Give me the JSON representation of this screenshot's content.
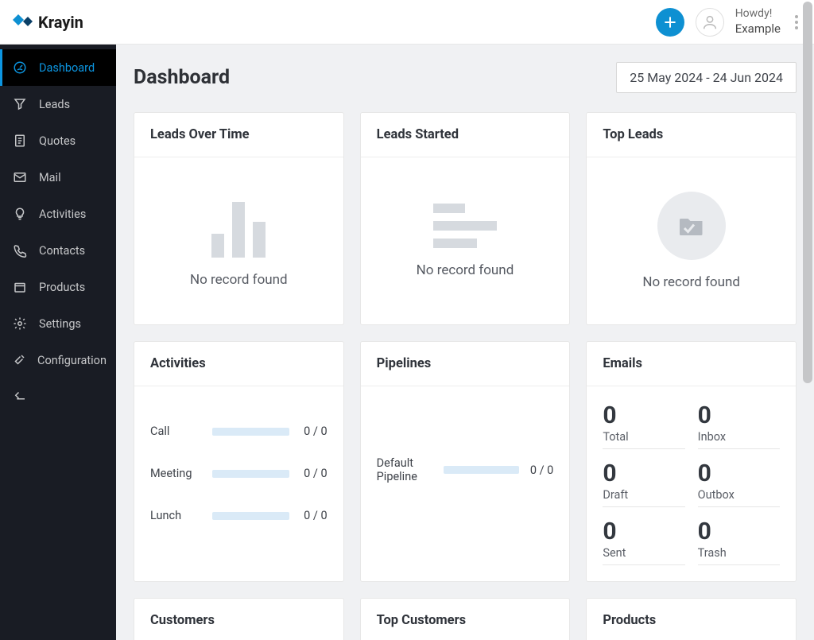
{
  "app_name": "Krayin",
  "header": {
    "greeting": "Howdy!",
    "user_name": "Example"
  },
  "sidebar": {
    "items": [
      {
        "label": "Dashboard"
      },
      {
        "label": "Leads"
      },
      {
        "label": "Quotes"
      },
      {
        "label": "Mail"
      },
      {
        "label": "Activities"
      },
      {
        "label": "Contacts"
      },
      {
        "label": "Products"
      },
      {
        "label": "Settings"
      },
      {
        "label": "Configuration"
      }
    ]
  },
  "page": {
    "title": "Dashboard",
    "date_range": "25 May 2024 - 24 Jun 2024",
    "no_record": "No record found"
  },
  "cards": {
    "leads_over_time": {
      "title": "Leads Over Time"
    },
    "leads_started": {
      "title": "Leads Started"
    },
    "top_leads": {
      "title": "Top Leads"
    },
    "activities": {
      "title": "Activities",
      "rows": [
        {
          "label": "Call",
          "count": "0 / 0"
        },
        {
          "label": "Meeting",
          "count": "0 / 0"
        },
        {
          "label": "Lunch",
          "count": "0 / 0"
        }
      ]
    },
    "pipelines": {
      "title": "Pipelines",
      "rows": [
        {
          "label": "Default Pipeline",
          "count": "0 / 0"
        }
      ]
    },
    "emails": {
      "title": "Emails",
      "stats": [
        {
          "value": "0",
          "label": "Total"
        },
        {
          "value": "0",
          "label": "Inbox"
        },
        {
          "value": "0",
          "label": "Draft"
        },
        {
          "value": "0",
          "label": "Outbox"
        },
        {
          "value": "0",
          "label": "Sent"
        },
        {
          "value": "0",
          "label": "Trash"
        }
      ]
    },
    "customers": {
      "title": "Customers"
    },
    "top_customers": {
      "title": "Top Customers"
    },
    "products": {
      "title": "Products"
    }
  }
}
